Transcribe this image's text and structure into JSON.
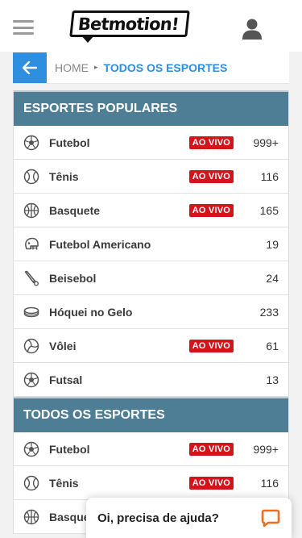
{
  "header": {
    "logo_text": "Betmotion!",
    "menu_icon": "hamburger-menu-icon",
    "user_icon": "user-account-icon"
  },
  "breadcrumb": {
    "home": "HOME",
    "separator": "▸",
    "current": "TODOS OS ESPORTES",
    "back_icon": "arrow-left-icon"
  },
  "colors": {
    "accent": "#2e8ee0",
    "section_header": "#4e7e96",
    "live_badge": "#d4141b",
    "chat_icon": "#f36c21"
  },
  "popular": {
    "title": "ESPORTES POPULARES",
    "items": [
      {
        "name": "Futebol",
        "live": "AO VIVO",
        "count": "999+",
        "icon": "soccer-ball-icon"
      },
      {
        "name": "Tênis",
        "live": "AO VIVO",
        "count": "116",
        "icon": "tennis-ball-icon"
      },
      {
        "name": "Basquete",
        "live": "AO VIVO",
        "count": "165",
        "icon": "basketball-icon"
      },
      {
        "name": "Futebol Americano",
        "live": "",
        "count": "19",
        "icon": "football-helmet-icon"
      },
      {
        "name": "Beisebol",
        "live": "",
        "count": "24",
        "icon": "baseball-bat-icon"
      },
      {
        "name": "Hóquei no Gelo",
        "live": "",
        "count": "233",
        "icon": "hockey-puck-icon"
      },
      {
        "name": "Vôlei",
        "live": "AO VIVO",
        "count": "61",
        "icon": "volleyball-icon"
      },
      {
        "name": "Futsal",
        "live": "",
        "count": "13",
        "icon": "futsal-ball-icon"
      }
    ]
  },
  "all_sports": {
    "title": "TODOS OS ESPORTES",
    "items": [
      {
        "name": "Futebol",
        "live": "AO VIVO",
        "count": "999+",
        "icon": "soccer-ball-icon"
      },
      {
        "name": "Tênis",
        "live": "AO VIVO",
        "count": "116",
        "icon": "tennis-ball-icon"
      },
      {
        "name": "Basquete",
        "live": "",
        "count": "",
        "icon": "basketball-icon"
      }
    ]
  },
  "chat": {
    "text": "Oi, precisa de ajuda?",
    "icon": "chat-bubble-icon"
  }
}
